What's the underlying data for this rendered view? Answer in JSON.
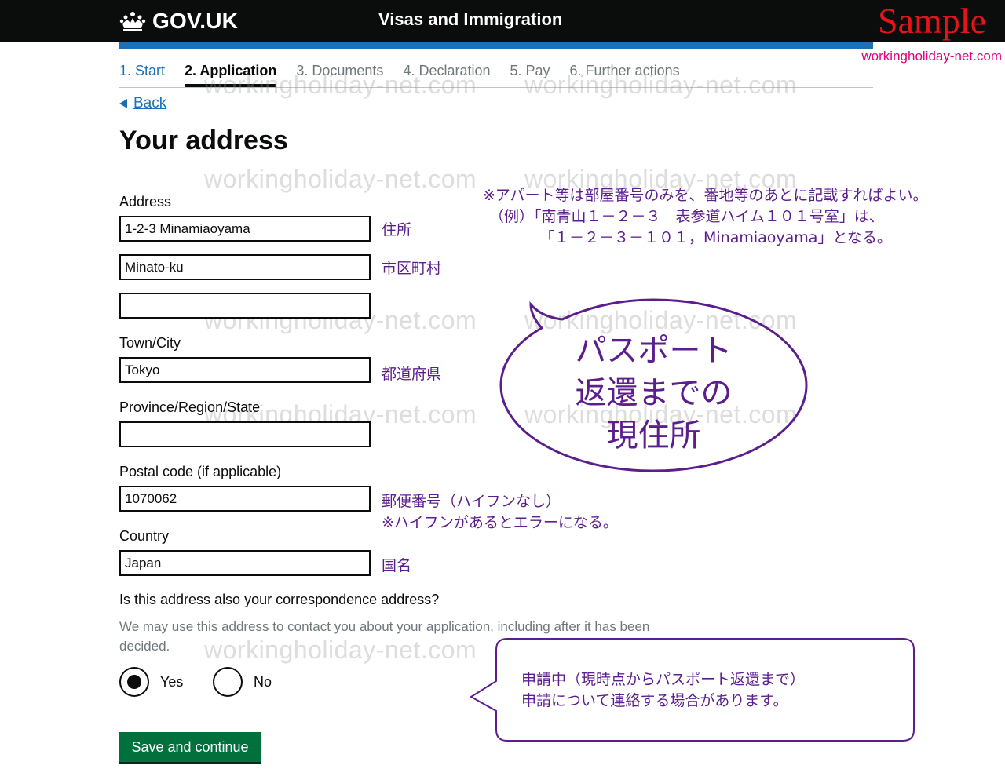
{
  "header": {
    "logo_text": "GOV.UK",
    "service_name": "Visas and Immigration",
    "sample_label": "Sample",
    "site_url": "workingholiday-net.com"
  },
  "steps": [
    {
      "label": "1. Start",
      "state": "done"
    },
    {
      "label": "2. Application",
      "state": "current"
    },
    {
      "label": "3. Documents",
      "state": "todo"
    },
    {
      "label": "4. Declaration",
      "state": "todo"
    },
    {
      "label": "5. Pay",
      "state": "todo"
    },
    {
      "label": "6. Further actions",
      "state": "todo"
    }
  ],
  "back_label": "Back",
  "page_title": "Your address",
  "form": {
    "address_label": "Address",
    "address_line1": "1-2-3 Minamiaoyama",
    "address_line2": "Minato-ku",
    "address_line3": "",
    "town_label": "Town/City",
    "town_value": "Tokyo",
    "province_label": "Province/Region/State",
    "province_value": "",
    "postal_label": "Postal code (if applicable)",
    "postal_value": "1070062",
    "country_label": "Country",
    "country_value": "Japan",
    "question": "Is this address also your correspondence address?",
    "hint": "We may use this address to contact you about your application, including after it has been decided.",
    "yes_label": "Yes",
    "no_label": "No",
    "selected": "yes",
    "save_label": "Save and continue"
  },
  "annotations": {
    "address_jp": "住所",
    "line2_jp": "市区町村",
    "town_jp": "都道府県",
    "postal_jp_1": "郵便番号（ハイフンなし）",
    "postal_jp_2": "※ハイフンがあるとエラーになる。",
    "country_jp": "国名",
    "note_1": "※アパート等は部屋番号のみを、番地等のあとに記載すればよい。",
    "note_2": "（例）「南青山１－２－３　表参道ハイム１０１号室」は、",
    "note_3": "「１－２－３－１０１，Minamiaoyama」となる。",
    "oval_1": "パスポート",
    "oval_2": "返還までの",
    "oval_3": "現住所",
    "box_1": "申請中（現時点からパスポート返還まで）",
    "box_2": "申請について連絡する場合があります。"
  },
  "watermark_text": "workingholiday-net.com",
  "colors": {
    "annotation": "#5c1e8c",
    "header_bg": "#0b0c0c",
    "header_blue": "#1d70b8",
    "link": "#1d70b8",
    "button": "#00703c",
    "sample": "#e4141b",
    "site_url": "#e4007f"
  }
}
